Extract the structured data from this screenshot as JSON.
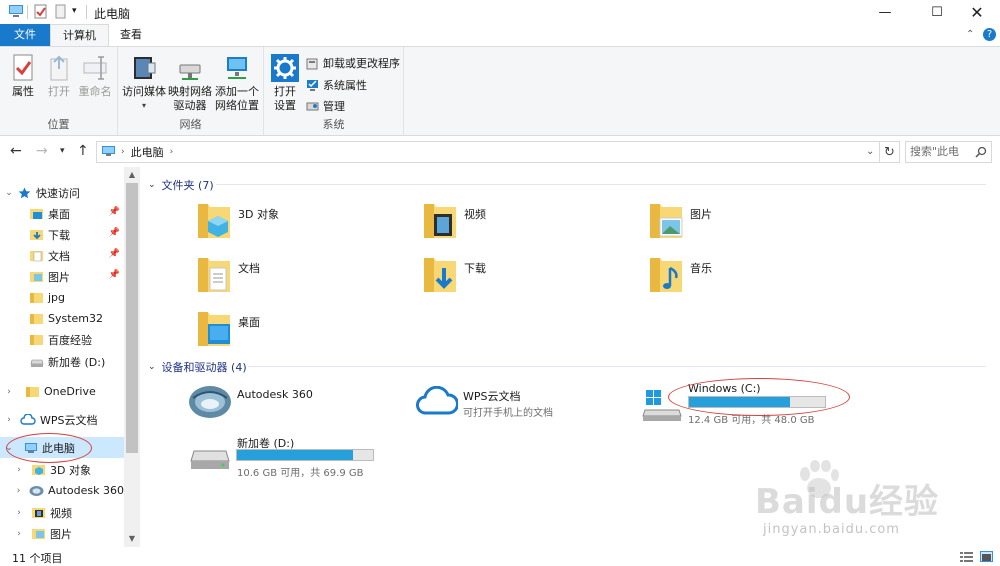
{
  "window": {
    "title": "此电脑",
    "controls": [
      "minimize-icon",
      "maximize-icon",
      "close-icon"
    ]
  },
  "ribbon": {
    "tabs": [
      {
        "label": "文件"
      },
      {
        "label": "计算机"
      },
      {
        "label": "查看"
      }
    ],
    "groups": {
      "location": {
        "label": "位置",
        "buttons": [
          {
            "label": "属性",
            "icon": "checkmark-document-icon",
            "enabled": true
          },
          {
            "label": "打开",
            "icon": "open-arrow-icon",
            "enabled": false
          },
          {
            "label": "重命名",
            "icon": "rename-icon",
            "enabled": false
          }
        ]
      },
      "network": {
        "label": "网络",
        "buttons": [
          {
            "label": "访问媒体",
            "icon": "media-icon"
          },
          {
            "label": "映射网络驱动器",
            "line1": "映射网络",
            "line2": "驱动器",
            "icon": "map-drive-icon"
          },
          {
            "label": "添加一个网络位置",
            "line1": "添加一个",
            "line2": "网络位置",
            "icon": "network-location-icon"
          }
        ]
      },
      "system": {
        "label": "系统",
        "open_settings": {
          "line1": "打开",
          "line2": "设置",
          "icon": "gear-icon"
        },
        "small_buttons": [
          {
            "label": "卸载或更改程序",
            "icon": "uninstall-icon"
          },
          {
            "label": "系统属性",
            "icon": "system-properties-icon"
          },
          {
            "label": "管理",
            "icon": "manage-icon"
          }
        ]
      }
    }
  },
  "address": {
    "breadcrumb": "此电脑",
    "search_placeholder": "搜索\"此电"
  },
  "nav_pane": {
    "items": [
      {
        "label": "快速访问",
        "icon": "star-icon",
        "indent": 0,
        "arrow": "expanded"
      },
      {
        "label": "桌面",
        "icon": "desktop-folder-icon",
        "indent": 1,
        "pinned": true
      },
      {
        "label": "下载",
        "icon": "downloads-folder-icon",
        "indent": 1,
        "pinned": true
      },
      {
        "label": "文档",
        "icon": "documents-folder-icon",
        "indent": 1,
        "pinned": true
      },
      {
        "label": "图片",
        "icon": "pictures-folder-icon",
        "indent": 1,
        "pinned": true
      },
      {
        "label": "jpg",
        "icon": "folder-icon",
        "indent": 1
      },
      {
        "label": "System32",
        "icon": "folder-icon",
        "indent": 1
      },
      {
        "label": "百度经验",
        "icon": "folder-icon",
        "indent": 1
      },
      {
        "label": "新加卷 (D:)",
        "icon": "drive-icon",
        "indent": 1
      },
      {
        "label": "OneDrive",
        "icon": "folder-icon",
        "indent": 0,
        "arrow": "collapsed"
      },
      {
        "label": "WPS云文档",
        "icon": "cloud-icon",
        "indent": 0,
        "arrow": "collapsed"
      },
      {
        "label": "此电脑",
        "icon": "computer-icon",
        "indent": 0,
        "arrow": "expanded",
        "selected": true
      },
      {
        "label": "3D 对象",
        "icon": "3d-objects-icon",
        "indent": 1,
        "arrow": "collapsed"
      },
      {
        "label": "Autodesk 360",
        "icon": "autodesk-icon",
        "indent": 1,
        "arrow": "collapsed"
      },
      {
        "label": "视频",
        "icon": "videos-folder-icon",
        "indent": 1,
        "arrow": "collapsed"
      },
      {
        "label": "图片",
        "icon": "pictures-folder-icon",
        "indent": 1,
        "arrow": "collapsed"
      }
    ]
  },
  "content": {
    "folders_group": {
      "label": "文件夹 (7)"
    },
    "folders": [
      {
        "label": "3D 对象",
        "icon": "3d-objects-folder-icon"
      },
      {
        "label": "视频",
        "icon": "videos-folder-icon"
      },
      {
        "label": "图片",
        "icon": "pictures-folder-icon"
      },
      {
        "label": "文档",
        "icon": "documents-folder-icon"
      },
      {
        "label": "下载",
        "icon": "downloads-folder-icon"
      },
      {
        "label": "音乐",
        "icon": "music-folder-icon"
      },
      {
        "label": "桌面",
        "icon": "desktop-folder-icon"
      }
    ],
    "devices_group": {
      "label": "设备和驱动器 (4)"
    },
    "devices": [
      {
        "label": "Autodesk 360",
        "icon": "autodesk-360-icon"
      },
      {
        "label": "WPS云文档",
        "sub": "可打开手机上的文档",
        "icon": "wps-cloud-icon"
      },
      {
        "label": "Windows (C:)",
        "sub": "12.4 GB 可用，共 48.0 GB",
        "used_fraction": 0.74,
        "icon": "windows-drive-icon"
      },
      {
        "label": "新加卷 (D:)",
        "sub": "10.6 GB 可用，共 69.9 GB",
        "used_fraction": 0.85,
        "icon": "drive-icon"
      }
    ]
  },
  "status": {
    "count": "11 个项目",
    "views": [
      "details-view-icon",
      "large-icons-view-icon"
    ]
  },
  "watermark": {
    "logo": "Baidu经验",
    "url": "jingyan.baidu.com"
  },
  "colors": {
    "accent": "#1979ca",
    "selection": "#cce8ff",
    "bar_fill": "#26a0da",
    "folder": "#f8d775",
    "annotation": "#d9403a"
  }
}
